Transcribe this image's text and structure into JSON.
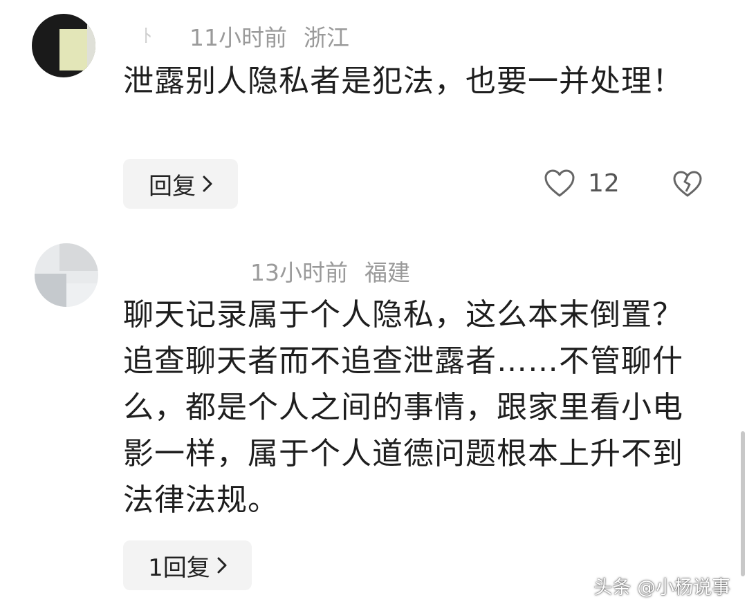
{
  "comments": [
    {
      "time": "11小时前",
      "location": "浙江",
      "text": "泄露别人隐私者是犯法，也要一并处理！",
      "reply_label": "回复",
      "likes": "12"
    },
    {
      "time": "13小时前",
      "location": "福建",
      "text": "聊天记录属于个人隐私，这么本末倒置？追查聊天者而不追查泄露者……不管聊什么，都是个人之间的事情，跟家里看小电影一样，属于个人道德问题根本上升不到法律法规。",
      "reply_label": "1回复"
    }
  ],
  "watermark": "头条 @小杨说事",
  "icons": {
    "like": "heart-outline-icon",
    "dislike": "broken-heart-icon",
    "chevron": "chevron-right-icon"
  }
}
